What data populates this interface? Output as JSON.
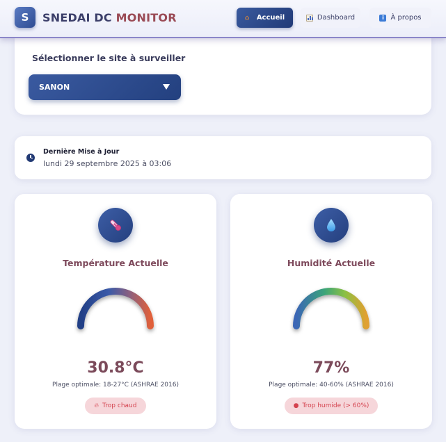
{
  "header": {
    "logo_letter": "S",
    "brand_part1": "SNEDAI DC ",
    "brand_part2": "MONITOR",
    "nav": {
      "home": "Accueil",
      "dashboard": "Dashboard",
      "about": "À propos"
    }
  },
  "site": {
    "title": "Sélectionner le site à surveiller",
    "selected": "SANON"
  },
  "update": {
    "label": "Dernière Mise à Jour",
    "value": "lundi 29 septembre 2025 à 03:06"
  },
  "temperature": {
    "title": "Température Actuelle",
    "value": "30.8°C",
    "range": "Plage optimale: 18-27°C (ASHRAE 2016)",
    "status": "Trop chaud",
    "gauge_colors": [
      "#223f86",
      "#3a5aa8",
      "#8a6080",
      "#e0603a"
    ]
  },
  "humidity": {
    "title": "Humidité Actuelle",
    "value": "77%",
    "range": "Plage optimale: 40-60% (ASHRAE 2016)",
    "status": "Trop humide (> 60%)",
    "gauge_colors": [
      "#3a66b5",
      "#3aa47a",
      "#8cc043",
      "#e0a030"
    ]
  },
  "colors": {
    "accent": "#2a4688",
    "brand_red": "#9a4a55",
    "alert_bg": "#f6d6da",
    "alert_text": "#d4434f"
  }
}
